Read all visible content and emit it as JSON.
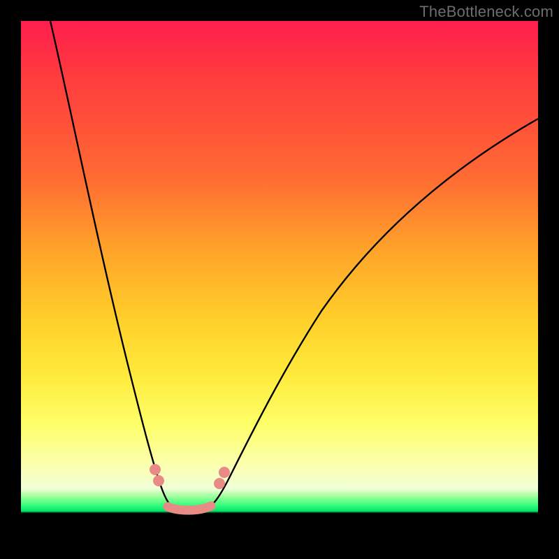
{
  "watermark": "TheBottleneck.com",
  "chart_data": {
    "type": "line",
    "title": "",
    "xlabel": "",
    "ylabel": "",
    "xlim": [
      0,
      100
    ],
    "ylim": [
      0,
      100
    ],
    "grid": false,
    "legend": false,
    "background_gradient": {
      "orientation": "vertical",
      "stops": [
        {
          "pos": 0,
          "color": "#ff1e4e",
          "meaning": "severe bottleneck"
        },
        {
          "pos": 50,
          "color": "#ffc62a",
          "meaning": "moderate bottleneck"
        },
        {
          "pos": 85,
          "color": "#fbffb0",
          "meaning": "mild bottleneck"
        },
        {
          "pos": 93,
          "color": "#00e56a",
          "meaning": "balanced"
        },
        {
          "pos": 100,
          "color": "#000000",
          "meaning": "frame"
        }
      ]
    },
    "series": [
      {
        "name": "bottleneck-curve",
        "x": [
          0,
          4,
          8,
          12,
          16,
          20,
          23,
          26,
          28,
          30,
          32,
          34,
          38,
          44,
          52,
          62,
          74,
          88,
          100
        ],
        "y_pct": [
          100,
          92,
          83,
          73,
          62,
          48,
          33,
          19,
          10,
          4,
          2,
          4,
          12,
          26,
          42,
          57,
          69,
          79,
          86
        ],
        "note": "y_pct is bottleneck severity percent (0 = balanced/green, 100 = severe/red top). Curve dips to ~0 near x≈31 and rises on both sides; left branch starts at top-left corner, right branch exits midway up right edge."
      }
    ],
    "highlight_band": {
      "x_range": [
        25,
        37
      ],
      "note": "salmon-colored markers and thick segment near the curve minimum"
    }
  }
}
